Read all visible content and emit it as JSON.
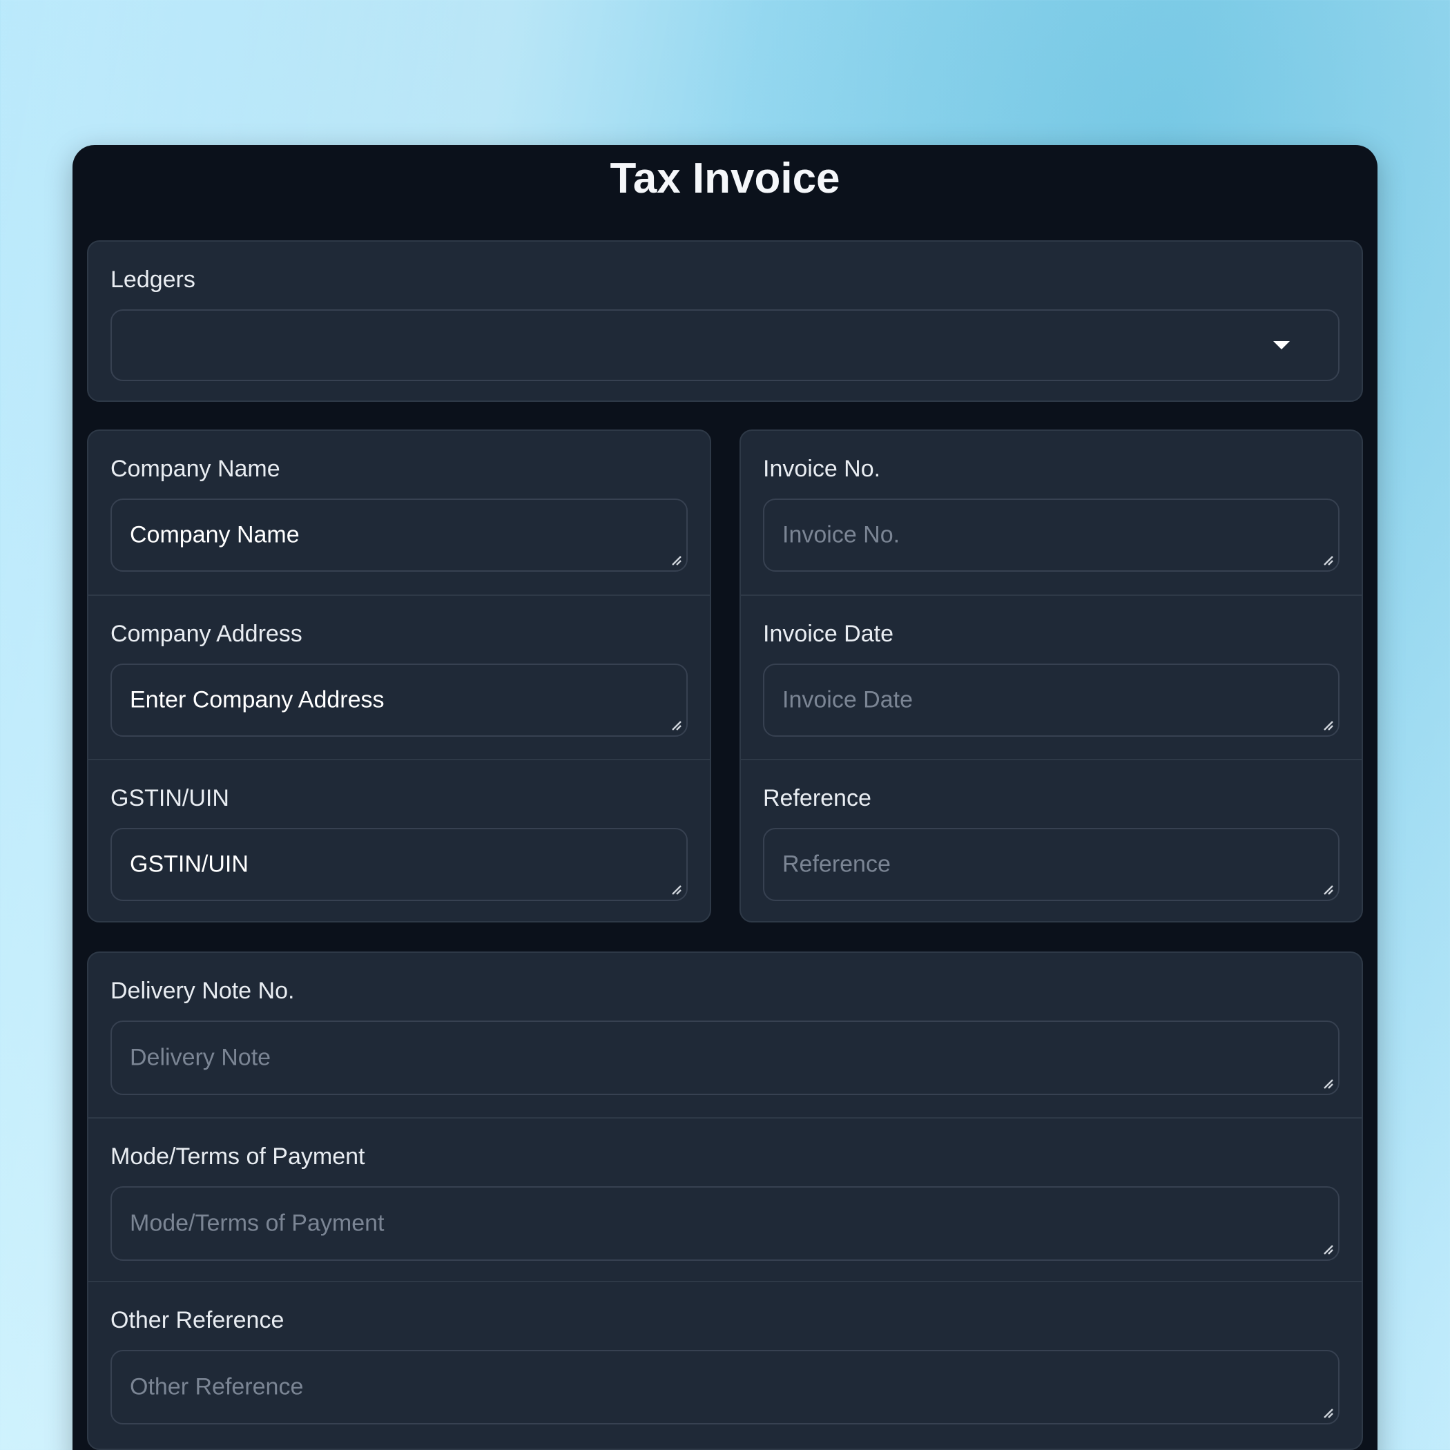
{
  "page": {
    "title": "Tax Invoice"
  },
  "ledgers": {
    "label": "Ledgers",
    "selected": ""
  },
  "left_panel": {
    "company_name": {
      "label": "Company Name",
      "value": "Company Name"
    },
    "company_address": {
      "label": "Company Address",
      "value": "Enter Company Address"
    },
    "gstin": {
      "label": "GSTIN/UIN",
      "value": "GSTIN/UIN"
    }
  },
  "right_panel": {
    "invoice_no": {
      "label": "Invoice No.",
      "placeholder": "Invoice No."
    },
    "invoice_date": {
      "label": "Invoice Date",
      "placeholder": "Invoice Date"
    },
    "reference": {
      "label": "Reference",
      "placeholder": "Reference"
    }
  },
  "bottom_panel": {
    "delivery_note": {
      "label": "Delivery Note No.",
      "placeholder": "Delivery Note"
    },
    "payment_terms": {
      "label": "Mode/Terms of Payment",
      "placeholder": "Mode/Terms of Payment"
    },
    "other_reference": {
      "label": "Other Reference",
      "placeholder": "Other Reference"
    }
  },
  "icons": {
    "dropdown": "chevron-down-icon",
    "resize": "resize-handle-icon"
  },
  "colors": {
    "card_bg": "#0b111b",
    "panel_bg": "#1f2937",
    "border": "#374151",
    "text": "#e9edf2",
    "placeholder": "#7b8594"
  }
}
